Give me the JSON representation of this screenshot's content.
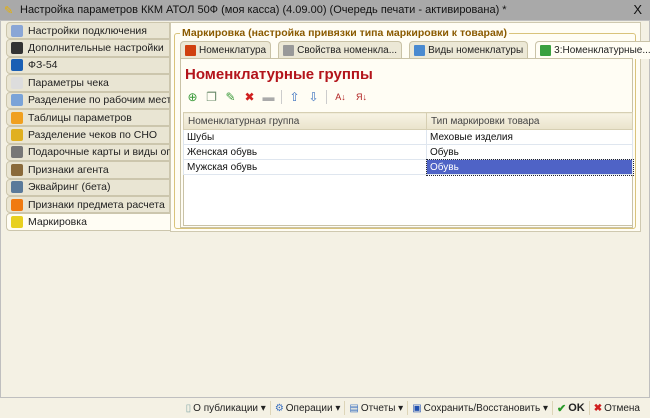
{
  "window": {
    "title": "Настройка параметров ККМ АТОЛ 50Ф (моя касса) (4.09.00) (Очередь печати - активирована) *",
    "close": "X"
  },
  "sidebar": {
    "items": [
      {
        "label": "Настройки подключения",
        "color": "#8aa6d6"
      },
      {
        "label": "Дополнительные настройки",
        "color": "#333333"
      },
      {
        "label": "ФЗ-54",
        "color": "#1a5fb4"
      },
      {
        "label": "Параметры чека",
        "color": "#dddddd"
      },
      {
        "label": "Разделение по рабочим местам",
        "color": "#7aa3d8"
      },
      {
        "label": "Таблицы параметров",
        "color": "#f0a020"
      },
      {
        "label": "Разделение чеков по СНО",
        "color": "#e0b020"
      },
      {
        "label": "Подарочные карты и виды оплат",
        "color": "#777777"
      },
      {
        "label": "Признаки агента",
        "color": "#8a6a3a"
      },
      {
        "label": "Эквайринг (бета)",
        "color": "#5a7a9a"
      },
      {
        "label": "Признаки предмета расчета",
        "color": "#f07a10"
      },
      {
        "label": "Маркировка",
        "color": "#e8d020"
      }
    ],
    "active": 11
  },
  "group": {
    "label": "Маркировка (настройка привязки типа маркировки к товарам)"
  },
  "tabs": [
    {
      "label": "Номенклатура",
      "color": "#d04010"
    },
    {
      "label": "Свойства номенкла...",
      "color": "#999999"
    },
    {
      "label": "Виды номенклатуры",
      "color": "#4a8ad0"
    },
    {
      "label": "3:Номенклатурные...",
      "color": "#3aa040"
    }
  ],
  "main": {
    "title": "Номенклатурные группы",
    "toolbar": {
      "add": "⊕",
      "copy": "❐",
      "edit": "✎",
      "delete": "✖",
      "save": "▬",
      "up": "⇧",
      "down": "⇩",
      "sort_asc": "A↓",
      "sort_desc": "Я↓"
    },
    "table": {
      "columns": [
        "Номенклатурная группа",
        "Тип маркировки товара"
      ],
      "rows": [
        [
          "Шубы",
          "Меховые изделия"
        ],
        [
          "Женская обувь",
          "Обувь"
        ],
        [
          "Мужская обувь",
          "Обувь"
        ]
      ]
    }
  },
  "bottom": {
    "publications": "О публикации",
    "operations": "Операции",
    "reports": "Отчеты",
    "save_restore": "Сохранить/Восстановить",
    "ok": "OK",
    "cancel": "Отмена"
  }
}
